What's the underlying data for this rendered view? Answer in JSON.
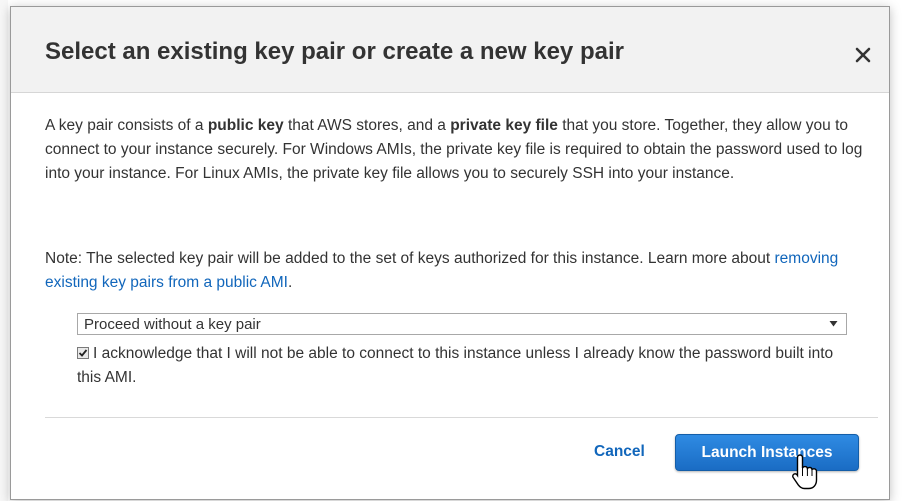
{
  "dialog": {
    "title": "Select an existing key pair or create a new key pair",
    "close_label": "×"
  },
  "description": {
    "part1": "A key pair consists of a ",
    "bold1": "public key",
    "part2": " that AWS stores, and a ",
    "bold2": "private key file",
    "part3": " that you store. Together, they allow you to connect to your instance securely. For Windows AMIs, the private key file is required to obtain the password used to log into your instance. For Linux AMIs, the private key file allows you to securely SSH into your instance."
  },
  "note": {
    "text": "Note: The selected key pair will be added to the set of keys authorized for this instance. Learn more about ",
    "link_text": "removing existing key pairs from a public AMI",
    "suffix": "."
  },
  "key_pair_select": {
    "selected": "Proceed without a key pair"
  },
  "acknowledge": {
    "checked": true,
    "label": "I acknowledge that I will not be able to connect to this instance unless I already know the password built into this AMI."
  },
  "footer": {
    "cancel_label": "Cancel",
    "launch_label": "Launch Instances"
  },
  "colors": {
    "link": "#1166bb",
    "primary_button": "#1a6cc4",
    "header_bg": "#f2f2f2"
  }
}
